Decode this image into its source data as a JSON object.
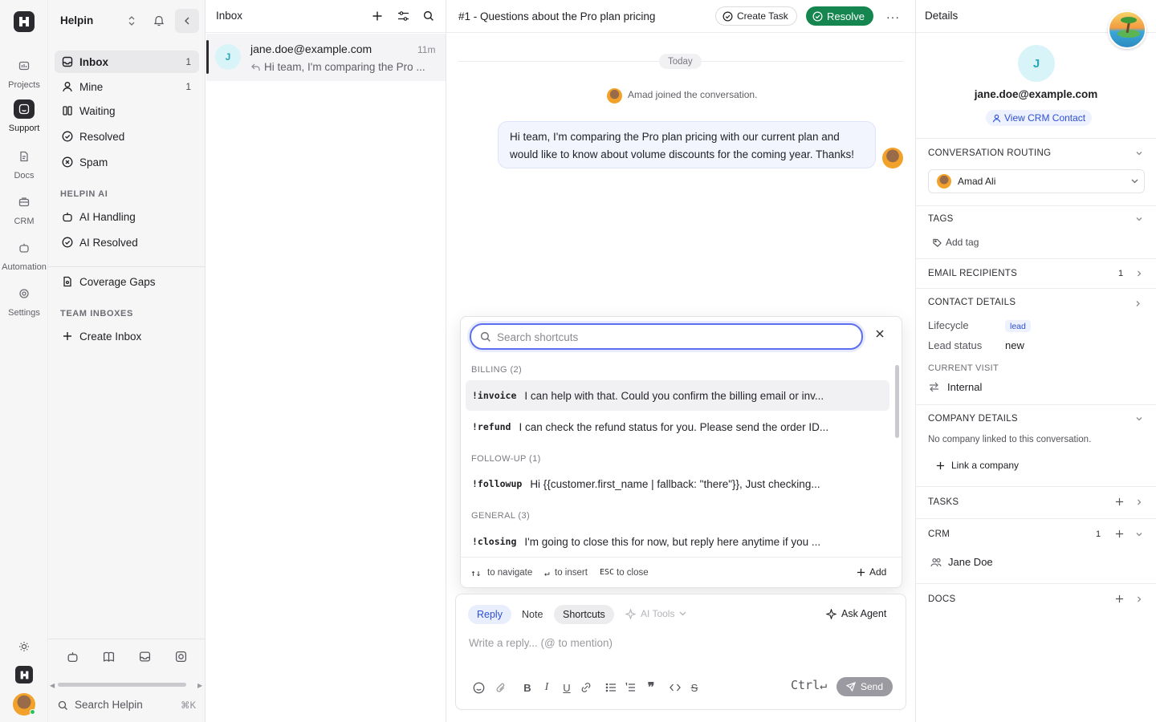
{
  "app": {
    "name": "Helpin"
  },
  "rail": {
    "items": [
      {
        "label": "Projects",
        "icon": "projects-icon"
      },
      {
        "label": "Support",
        "icon": "support-icon",
        "active": true
      },
      {
        "label": "Docs",
        "icon": "docs-icon"
      },
      {
        "label": "CRM",
        "icon": "crm-icon"
      },
      {
        "label": "Automation",
        "icon": "automation-icon"
      },
      {
        "label": "Settings",
        "icon": "settings-icon"
      }
    ]
  },
  "sidebar": {
    "items": [
      {
        "label": "Inbox",
        "count": "1",
        "icon": "inbox-icon"
      },
      {
        "label": "Mine",
        "count": "1",
        "icon": "user-icon"
      },
      {
        "label": "Waiting",
        "icon": "waiting-icon"
      },
      {
        "label": "Resolved",
        "icon": "check-circle-icon"
      },
      {
        "label": "Spam",
        "icon": "x-circle-icon"
      }
    ],
    "ai_section": "HELPIN AI",
    "ai_items": [
      {
        "label": "AI Handling",
        "icon": "bot-icon"
      },
      {
        "label": "AI Resolved",
        "icon": "check-circle-icon"
      }
    ],
    "coverage": "Coverage Gaps",
    "team_section": "TEAM INBOXES",
    "create_inbox": "Create Inbox",
    "search_placeholder": "Search Helpin",
    "search_shortcut": "⌘K"
  },
  "inbox": {
    "title": "Inbox",
    "conversation": {
      "avatar": "J",
      "email": "jane.doe@example.com",
      "time": "11m",
      "preview": "Hi team, I'm comparing the Pro ..."
    }
  },
  "conversation": {
    "title": "#1 - Questions about the Pro plan pricing",
    "create_task": "Create Task",
    "resolve": "Resolve",
    "date_divider": "Today",
    "event": "Amad joined the conversation.",
    "message": "Hi team, I'm comparing the Pro plan pricing with our current plan and would like to know about volume discounts for the coming year. Thanks!"
  },
  "shortcuts": {
    "search_placeholder": "Search shortcuts",
    "groups": [
      {
        "label": "BILLING (2)"
      },
      {
        "label": "FOLLOW-UP (1)"
      },
      {
        "label": "GENERAL (3)"
      }
    ],
    "items": [
      {
        "key": "!invoice",
        "text": "I can help with that. Could you confirm the billing email or inv..."
      },
      {
        "key": "!refund",
        "text": "I can check the refund status for you. Please send the order ID..."
      },
      {
        "key": "!followup",
        "text": "Hi {{customer.first_name | fallback: \"there\"}}, Just checking..."
      },
      {
        "key": "!closing",
        "text": "I'm going to close this for now, but reply here anytime if you ..."
      }
    ],
    "footer": {
      "navigate": "to navigate",
      "insert": "to insert",
      "esc": "ESC",
      "close": "to close",
      "add": "Add"
    }
  },
  "composer": {
    "tabs": [
      "Reply",
      "Note",
      "Shortcuts"
    ],
    "ai_tools": "AI Tools",
    "ask_agent": "Ask Agent",
    "placeholder": "Write a reply... (@ to mention)",
    "ctrl_hint": "Ctrl↵",
    "send": "Send"
  },
  "details": {
    "title": "Details",
    "avatar": "J",
    "email": "jane.doe@example.com",
    "view_crm": "View CRM Contact",
    "routing_label": "CONVERSATION ROUTING",
    "assignee": "Amad Ali",
    "tags_label": "TAGS",
    "add_tag": "Add tag",
    "email_recipients_label": "EMAIL RECIPIENTS",
    "email_recipients_count": "1",
    "contact_label": "CONTACT DETAILS",
    "lifecycle_label": "Lifecycle",
    "lifecycle_value": "lead",
    "lead_status_label": "Lead status",
    "lead_status_value": "new",
    "current_visit_label": "CURRENT VISIT",
    "current_visit_value": "Internal",
    "company_label": "COMPANY DETAILS",
    "no_company": "No company linked to this conversation.",
    "link_company": "Link a company",
    "tasks_label": "TASKS",
    "crm_label": "CRM",
    "crm_count": "1",
    "crm_contact": "Jane Doe",
    "docs_label": "DOCS"
  },
  "colors": {
    "accent": "#5b6ff0",
    "resolve_green": "#15864f",
    "avatar_teal": "#2aa6b8"
  }
}
